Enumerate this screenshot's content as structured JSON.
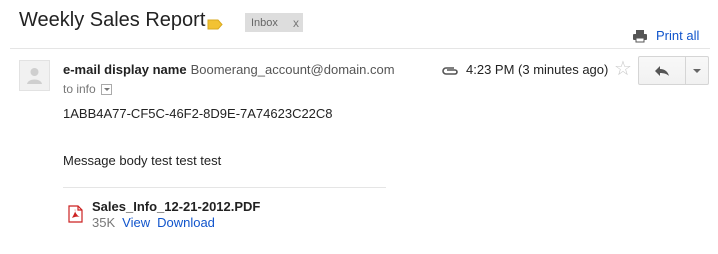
{
  "header": {
    "subject": "Weekly Sales Report",
    "label_color": "#f2c232",
    "inbox_label": "Inbox",
    "remove_label": "x",
    "print_all": "Print all"
  },
  "message": {
    "sender_name": "e-mail display name",
    "sender_email": "Boomerang_account@domain.com",
    "to_text": "to info",
    "timestamp": "4:23 PM (3 minutes ago)",
    "star_glyph": "☆",
    "id_line": "1ABB4A77-CF5C-46F2-8D9E-7A74623C22C8",
    "body": "Message body test test test"
  },
  "attachment": {
    "filename": "Sales_Info_12-21-2012.PDF",
    "size": "35K",
    "view_label": "View",
    "download_label": "Download"
  },
  "colors": {
    "link": "#1155cc",
    "pdf_red": "#cc2222"
  },
  "icons": [
    "label-tag-icon",
    "printer-icon",
    "avatar-icon",
    "paperclip-icon",
    "star-icon",
    "reply-arrow-icon",
    "chevron-down-icon",
    "pdf-file-icon"
  ]
}
